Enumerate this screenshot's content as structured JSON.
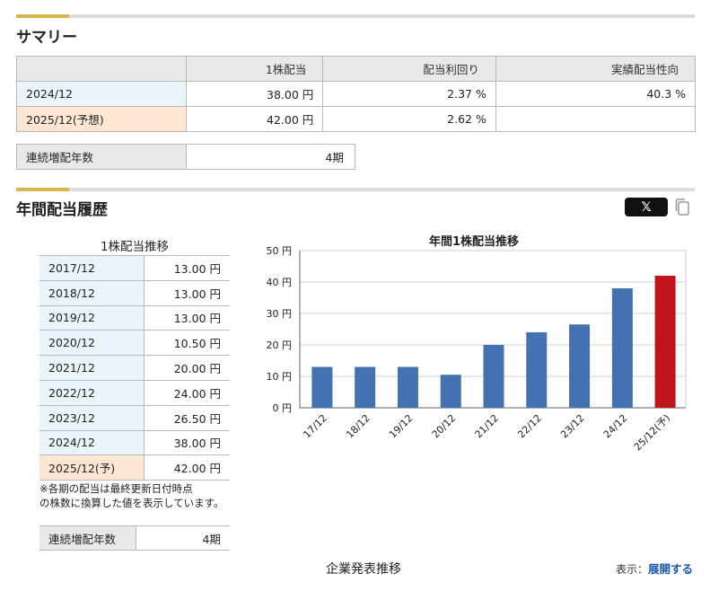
{
  "summary": {
    "title": "サマリー",
    "headers": [
      "",
      "1株配当",
      "配当利回り",
      "実績配当性向"
    ],
    "rows": [
      {
        "period": "2024/12",
        "dividend": "38.00 円",
        "yield": "2.37 %",
        "payout": "40.3 %"
      },
      {
        "period": "2025/12(予想)",
        "dividend": "42.00 円",
        "yield": "2.62 %",
        "payout": ""
      }
    ],
    "consecutive_label": "連続増配年数",
    "consecutive_value": "4期"
  },
  "history": {
    "title": "年間配当履歴",
    "share_button": "𝕏",
    "copy_icon": "copy-icon",
    "table_title": "1株配当推移",
    "rows": [
      {
        "year": "2017/12",
        "value": "13.00 円"
      },
      {
        "year": "2018/12",
        "value": "13.00 円"
      },
      {
        "year": "2019/12",
        "value": "13.00 円"
      },
      {
        "year": "2020/12",
        "value": "10.50 円"
      },
      {
        "year": "2021/12",
        "value": "20.00 円"
      },
      {
        "year": "2022/12",
        "value": "24.00 円"
      },
      {
        "year": "2023/12",
        "value": "26.50 円"
      },
      {
        "year": "2024/12",
        "value": "38.00 円"
      },
      {
        "year": "2025/12(予)",
        "value": "42.00 円"
      }
    ],
    "note_line1": "※各期の配当は最終更新日付時点",
    "note_line2": "の株数に換算した値を表示しています。",
    "consecutive_label": "連続増配年数",
    "consecutive_value": "4期"
  },
  "chart_data": {
    "type": "bar",
    "title": "年間1株配当推移",
    "categories": [
      "17/12",
      "18/12",
      "19/12",
      "20/12",
      "21/12",
      "22/12",
      "23/12",
      "24/12",
      "25/12(予)"
    ],
    "values": [
      13.0,
      13.0,
      13.0,
      10.5,
      20.0,
      24.0,
      26.5,
      38.0,
      42.0
    ],
    "ylim": [
      0,
      50
    ],
    "yticks": [
      "0 円",
      "10 円",
      "20 円",
      "30 円",
      "40 円",
      "50 円"
    ],
    "ytick_values": [
      0,
      10,
      20,
      30,
      40,
      50
    ],
    "grid": true,
    "bar_color": "#4472b0",
    "forecast_color": "#c0141c"
  },
  "forecast": {
    "heading": "企業発表推移",
    "display_label": "表示：",
    "expand_link": "展開する"
  }
}
